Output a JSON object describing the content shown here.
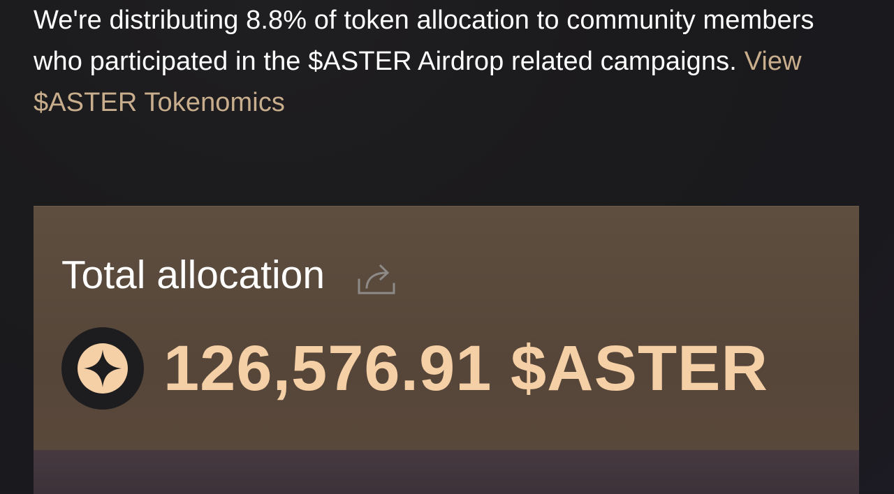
{
  "intro": {
    "text": "We're distributing 8.8% of token allocation to community members who participated in the $ASTER Airdrop related campaigns.",
    "link_label": "View $ASTER Tokenomics"
  },
  "allocation": {
    "title": "Total allocation",
    "share_icon": "share-icon",
    "token_icon": "aster-logo-icon",
    "amount": "126,576.91 $ASTER"
  },
  "colors": {
    "link": "#c9ae8e",
    "amount": "#f5cfa6",
    "card": "#5a4a3d",
    "background": "#1b1a1c"
  }
}
